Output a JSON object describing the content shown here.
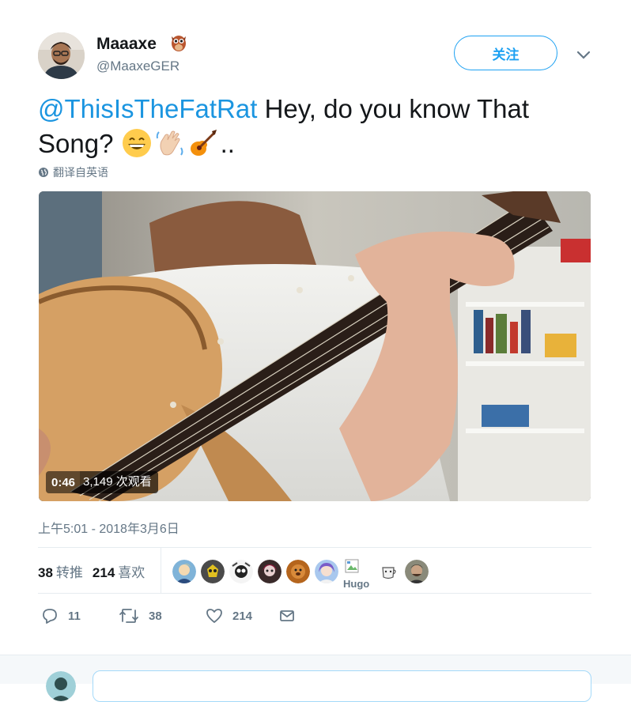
{
  "author": {
    "name": "Maaaxe",
    "handle": "@MaaxeGER",
    "badge_icon": "owl-emoji"
  },
  "follow_label": "关注",
  "tweet": {
    "mention": "@ThisIsTheFatRat",
    "body": " Hey, do you know That Song? ",
    "trail": "..",
    "emojis": [
      "grinning-face",
      "waving-hand",
      "guitar"
    ],
    "translate": "翻译自英语"
  },
  "video": {
    "duration": "0:46",
    "views": "3,149 次观看"
  },
  "timestamp": "上午5:01 - 2018年3月6日",
  "stats": {
    "retweets": "38",
    "retweets_label": "转推",
    "likes": "214",
    "likes_label": "喜欢"
  },
  "likers": {
    "hugo_label": "Hugo"
  },
  "actions": {
    "replies": "11",
    "retweets": "38",
    "likes": "214"
  },
  "colors": {
    "accent": "#1da1f2",
    "mention": "#1b95e0",
    "muted": "#657786"
  }
}
